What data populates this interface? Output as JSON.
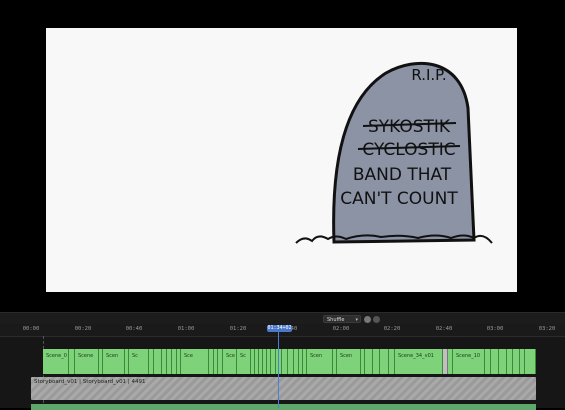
{
  "viewer": {
    "tombstone": {
      "header": "R.I.P.",
      "struck_names": [
        "SYKOSTIK",
        "CYCLOSTIC"
      ],
      "lines": [
        "BAND THAT",
        "CAN'T COUNT"
      ]
    }
  },
  "toolbar": {
    "shuffle_label": "Shuffle"
  },
  "ruler": {
    "ticks": [
      "00:00",
      "00:20",
      "00:40",
      "01:00",
      "01:20",
      "01:40",
      "02:00",
      "02:20",
      "02:40",
      "03:00",
      "03:20"
    ],
    "playhead_time": "01:34+02"
  },
  "video_track": {
    "clip_labels": [
      "Scene_0",
      "Scene",
      "Scen",
      "Sc",
      "Sce",
      "Sce",
      "Sc",
      "Scen",
      "Scen",
      "Scene_34_v01",
      "Scene_10"
    ]
  },
  "audio_track": {
    "label": "Storyboard_v01 | Storyboard_v01 | 4491"
  }
}
